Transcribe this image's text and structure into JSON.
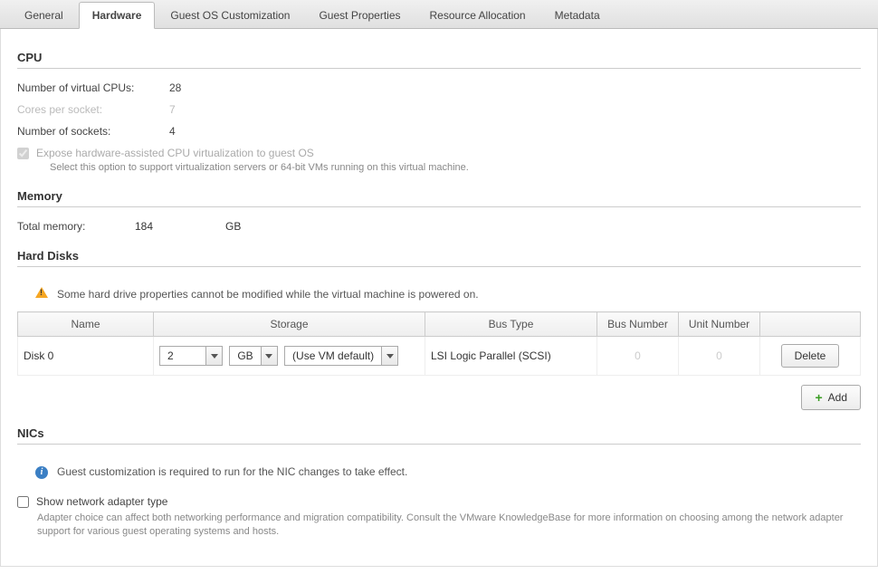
{
  "tabs": [
    "General",
    "Hardware",
    "Guest OS Customization",
    "Guest Properties",
    "Resource Allocation",
    "Metadata"
  ],
  "activeTab": 1,
  "cpu": {
    "title": "CPU",
    "vcpus_label": "Number of virtual CPUs:",
    "vcpus_value": "28",
    "cores_label": "Cores per socket:",
    "cores_value": "7",
    "sockets_label": "Number of sockets:",
    "sockets_value": "4",
    "expose_label": "Expose hardware-assisted CPU virtualization to guest OS",
    "expose_hint": "Select this option to support virtualization servers or 64-bit VMs running on this virtual machine."
  },
  "memory": {
    "title": "Memory",
    "total_label": "Total memory:",
    "total_value": "184",
    "total_unit": "GB"
  },
  "disks": {
    "title": "Hard Disks",
    "warning": "Some hard drive properties cannot be modified while the virtual machine is powered on.",
    "headers": {
      "name": "Name",
      "storage": "Storage",
      "bustype": "Bus Type",
      "busnum": "Bus Number",
      "unitnum": "Unit Number",
      "actions": ""
    },
    "rows": [
      {
        "name": "Disk 0",
        "size_value": "2",
        "size_unit": "GB",
        "policy": "(Use VM default)",
        "bustype": "LSI Logic Parallel (SCSI)",
        "busnum": "0",
        "unitnum": "0",
        "delete_label": "Delete"
      }
    ],
    "add_label": "Add"
  },
  "nics": {
    "title": "NICs",
    "info": "Guest customization is required to run for the NIC changes to take effect.",
    "show_adapter_label": "Show network adapter type",
    "show_adapter_hint": "Adapter choice can affect both networking performance and migration compatibility. Consult the VMware KnowledgeBase for more information on choosing among the network adapter support for various guest operating systems and hosts."
  }
}
